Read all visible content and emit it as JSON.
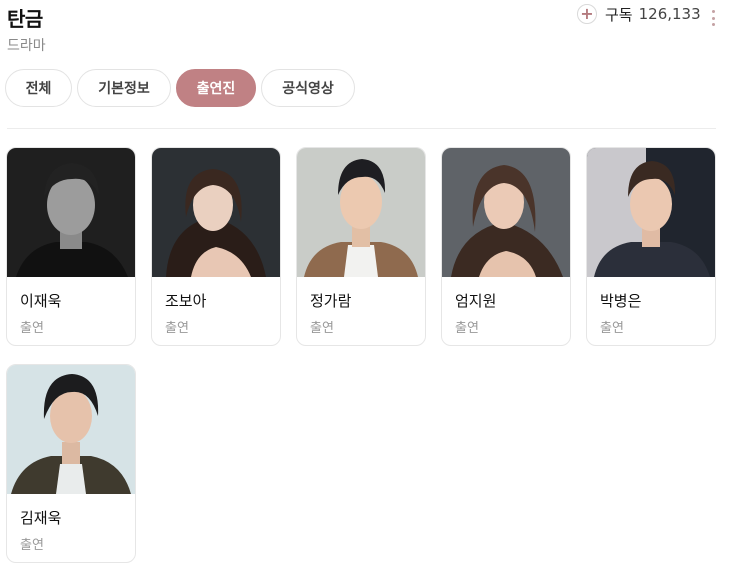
{
  "header": {
    "title": "탄금",
    "genre": "드라마",
    "subscribe_label": "구독",
    "subscriber_count": "126,133"
  },
  "tabs": [
    {
      "label": "전체",
      "active": false
    },
    {
      "label": "기본정보",
      "active": false
    },
    {
      "label": "출연진",
      "active": true
    },
    {
      "label": "공식영상",
      "active": false
    }
  ],
  "cast": [
    {
      "name": "이재욱",
      "role": "출연"
    },
    {
      "name": "조보아",
      "role": "출연"
    },
    {
      "name": "정가람",
      "role": "출연"
    },
    {
      "name": "엄지원",
      "role": "출연"
    },
    {
      "name": "박병은",
      "role": "출연"
    },
    {
      "name": "김재욱",
      "role": "출연"
    }
  ],
  "colors": {
    "accent": "#c08184",
    "subscribe_icon": "#b47b7f"
  }
}
